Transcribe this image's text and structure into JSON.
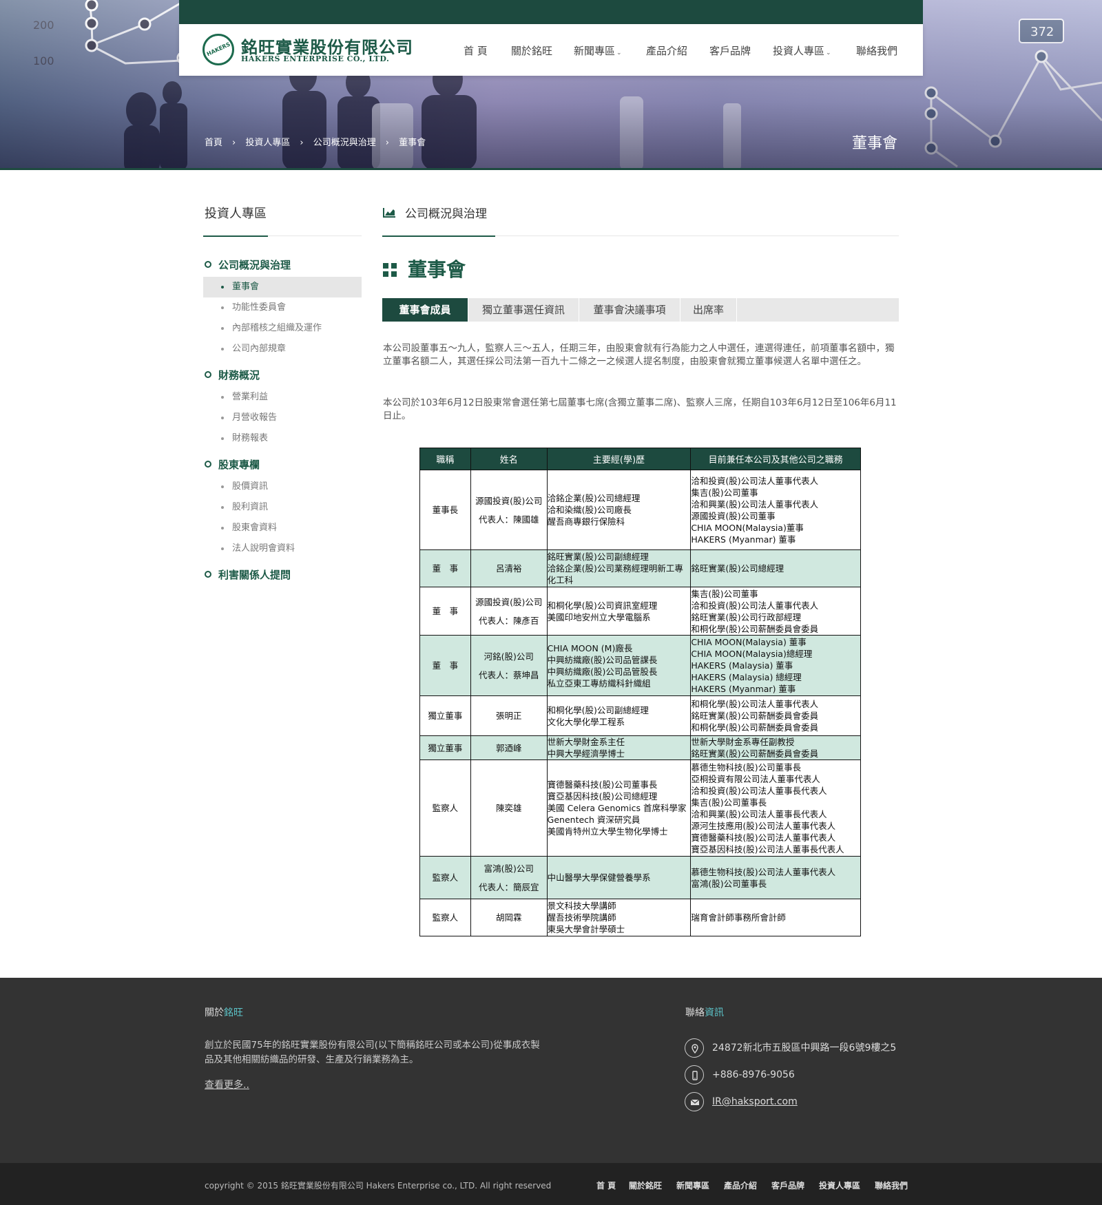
{
  "header": {
    "company_cn": "銘旺實業股份有限公司",
    "company_en": "HAKERS ENTERPRISE CO., LTD.",
    "logo_mark": "HAKERS",
    "nav": [
      "首 頁",
      "關於銘旺",
      "新聞專區",
      "產品介紹",
      "客戶品牌",
      "投資人專區",
      "聯絡我們"
    ],
    "hero_numbers": [
      "200",
      "100",
      "372"
    ],
    "breadcrumb": [
      "首頁",
      "投資人專區",
      "公司概況與治理",
      "董事會"
    ],
    "page_title": "董事會"
  },
  "sidebar": {
    "title": "投資人專區",
    "groups": [
      {
        "label": "公司概況與治理",
        "items": [
          "董事會",
          "功能性委員會",
          "內部稽核之組織及運作",
          "公司內部規章"
        ]
      },
      {
        "label": "財務概況",
        "items": [
          "營業利益",
          "月營收報告",
          "財務報表"
        ]
      },
      {
        "label": "股東專欄",
        "items": [
          "股價資訊",
          "股利資訊",
          "股東會資料",
          "法人說明會資料"
        ]
      },
      {
        "label": "利害關係人提問",
        "items": []
      }
    ]
  },
  "main": {
    "heading": "公司概況與治理",
    "section_title": "董事會",
    "tabs": [
      "董事會成員",
      "獨立董事選任資訊",
      "董事會決議事項",
      "出席率"
    ],
    "paragraph1": "本公司設董事五～九人，監察人三～五人，任期三年，由股東會就有行為能力之人中選任，連選得連任，前項董事名額中，獨立董事名額二人，其選任採公司法第一百九十二條之一之候選人提名制度，由股東會就獨立董事候選人名單中選任之。",
    "paragraph2": "本公司於103年6月12日股東常會選任第七屆董事七席(含獨立董事二席)、監察人三席，任期自103年6月12日至106年6月11日止。",
    "table": {
      "headers": [
        "職稱",
        "姓名",
        "主要經(學)歷",
        "目前兼任本公司及其他公司之職務"
      ],
      "rows": [
        {
          "title": "董事長",
          "name": [
            "源國投資(股)公司",
            "代表人：陳國雄"
          ],
          "exp": [
            "洽銘企業(股)公司總經理",
            "洽和染織(股)公司廠長",
            "醒吾商專銀行保險科"
          ],
          "roles": [
            "洽和投資(股)公司法人董事代表人",
            "集吉(股)公司董事",
            "洽和興業(股)公司法人董事代表人",
            "源國投資(股)公司董事",
            "CHIA MOON(Malaysia)董事",
            "HAKERS (Myanmar) 董事"
          ]
        },
        {
          "title": "董　事",
          "name": [
            "呂清裕"
          ],
          "exp": [
            "銘旺實業(股)公司副總經理",
            "洽銘企業(股)公司業務經理明新工專化工科"
          ],
          "roles": [
            "銘旺實業(股)公司總經理"
          ]
        },
        {
          "title": "董　事",
          "name": [
            "源國投資(股)公司",
            "代表人：陳彥百"
          ],
          "exp": [
            "和桐化學(股)公司資訊室經理",
            "美國印地安州立大學電腦系"
          ],
          "roles": [
            "集吉(股)公司董事",
            "洽和投資(股)公司法人董事代表人",
            "銘旺實業(股)公司行政部經理",
            "和桐化學(股)公司薪酬委員會委員"
          ]
        },
        {
          "title": "董　事",
          "name": [
            "河銘(股)公司",
            "代表人：蔡坤昌"
          ],
          "exp": [
            "CHIA MOON (M)廠長",
            "中興紡織廠(股)公司品管課長",
            "中興紡織廠(股)公司品管股長",
            "私立亞東工專紡織科針織組"
          ],
          "roles": [
            "CHIA MOON(Malaysia) 董事",
            "CHIA MOON(Malaysia)總經理",
            "HAKERS (Malaysia) 董事",
            "HAKERS (Malaysia) 總經理",
            "HAKERS (Myanmar) 董事"
          ]
        },
        {
          "title": "獨立董事",
          "name": [
            "張明正"
          ],
          "exp": [
            "和桐化學(股)公司副總經理",
            "文化大學化學工程系"
          ],
          "roles": [
            "和桐化學(股)公司法人董事代表人",
            "銘旺實業(股)公司薪酬委員會委員",
            "和桐化學(股)公司薪酬委員會委員"
          ]
        },
        {
          "title": "獨立董事",
          "name": [
            "郭迺峰"
          ],
          "exp": [
            "世新大學財金系主任",
            "中興大學經濟學博士"
          ],
          "roles": [
            "世新大學財金系專任副教授",
            "銘旺實業(股)公司薪酬委員會委員"
          ]
        },
        {
          "title": "監察人",
          "name": [
            "陳奕雄"
          ],
          "exp": [
            "寶德醫藥科技(股)公司董事長",
            "寶亞基因科技(股)公司總經理",
            "美國 Celera Genomics 首席科學家",
            "Genentech 資深研究員",
            "美國肯特州立大學生物化學博士"
          ],
          "roles": [
            "慕德生物科技(股)公司董事長",
            "亞桐投資有限公司法人董事代表人",
            "洽和投資(股)公司法人董事長代表人",
            "集吉(股)公司董事長",
            "洽和興業(股)公司法人董事長代表人",
            "源河生技應用(股)公司法人董事代表人",
            "寶德醫藥科技(股)公司法人董事代表人",
            "寶亞基因科技(股)公司法人董事長代表人"
          ]
        },
        {
          "title": "監察人",
          "name": [
            "富鴻(股)公司",
            "代表人：簡辰宜"
          ],
          "exp": [
            "中山醫學大學保健營養學系"
          ],
          "roles": [
            "慕德生物科技(股)公司法人董事代表人",
            "富鴻(股)公司董事長"
          ]
        },
        {
          "title": "監察人",
          "name": [
            "胡岡霖"
          ],
          "exp": [
            "景文科技大學講師",
            "醒吾技術學院講師",
            "東吳大學會計學碩士"
          ],
          "roles": [
            "瑞育會計師事務所會計師"
          ]
        }
      ]
    }
  },
  "footer": {
    "about_heading_a": "關於",
    "about_heading_b": "銘旺",
    "about_text": "創立於民國75年的銘旺實業股份有限公司(以下簡稱銘旺公司或本公司)從事成衣製品及其他相關紡織品的研發、生產及行銷業務為主。",
    "more_link": "查看更多",
    "contact_heading_a": "聯絡",
    "contact_heading_b": "資訊",
    "address": "24872新北市五股區中興路一段6號9樓之5",
    "phone": "+886-8976-9056",
    "email": "IR@haksport.com",
    "copyright": "copyright © 2015 銘旺實業股份有限公司 Hakers Enterprise co., LTD. All right reserved",
    "bottom_nav": [
      "首 頁",
      "關於銘旺",
      "新聞專區",
      "產品介紹",
      "客戶品牌",
      "投資人專區",
      "聯絡我們"
    ]
  },
  "colors": {
    "brand_green": "#1d4a3f",
    "accent_teal": "#5cc3c8",
    "table_highlight": "#d0e8df"
  },
  "icons": [
    "chart-area-icon",
    "grid-icon",
    "map-pin-icon",
    "phone-icon",
    "mail-icon",
    "chevron-down-icon",
    "chevron-right-icon"
  ]
}
